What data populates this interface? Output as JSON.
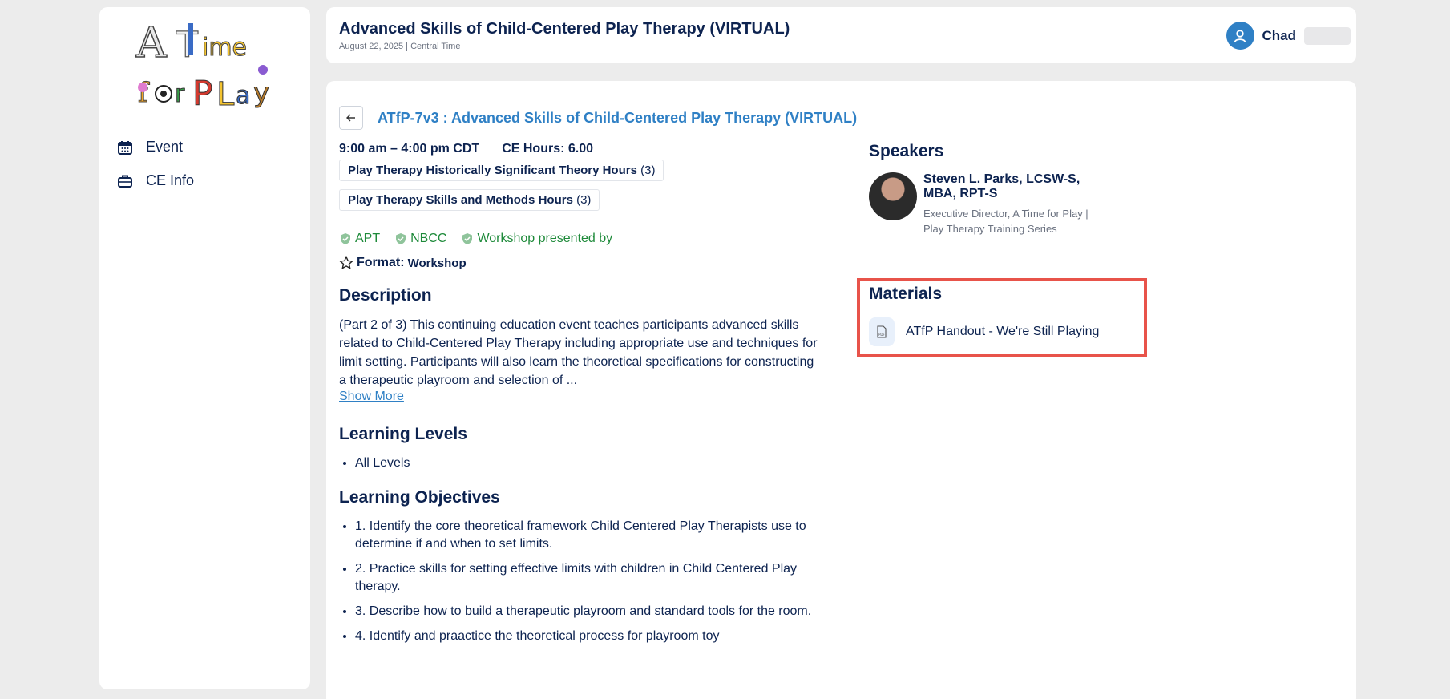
{
  "sidebar": {
    "logo_text_line1": "A Time",
    "logo_text_line2": "for Play",
    "items": [
      {
        "label": "Event",
        "icon": "calendar-icon"
      },
      {
        "label": "CE Info",
        "icon": "briefcase-icon"
      }
    ]
  },
  "header": {
    "title": "Advanced Skills of Child-Centered Play Therapy (VIRTUAL)",
    "subtitle": "August 22, 2025 | Central Time",
    "user_name": "Chad"
  },
  "event": {
    "title": "ATfP-7v3 : Advanced Skills of Child-Centered Play Therapy (VIRTUAL)",
    "time": "9:00 am – 4:00 pm CDT",
    "ce_hours": "CE Hours: 6.00",
    "tags": [
      {
        "label": "Play Therapy Historically Significant Theory Hours",
        "count": "(3)"
      },
      {
        "label": "Play Therapy Skills and Methods Hours",
        "count": "(3)"
      }
    ],
    "badges": [
      "APT",
      "NBCC",
      "Workshop presented by"
    ],
    "format_label": "Format:",
    "format_value": "Workshop"
  },
  "description": {
    "heading": "Description",
    "text": "(Part 2 of 3) This continuing education event teaches participants advanced skills related to Child-Centered Play Therapy including appropriate use and techniques for limit setting. Participants will also learn the theoretical specifications for constructing a therapeutic playroom and selection of ...",
    "show_more": "Show More"
  },
  "learning_levels": {
    "heading": "Learning Levels",
    "items": [
      "All Levels"
    ]
  },
  "learning_objectives": {
    "heading": "Learning Objectives",
    "items": [
      "1. Identify the core theoretical framework Child Centered Play Therapists use to determine if and when to set limits.",
      "2. Practice skills for setting effective limits with children in Child Centered Play therapy.",
      "3. Describe how to build a therapeutic playroom and standard tools for the room.",
      "4. Identify and praactice the theoretical process for playroom toy"
    ]
  },
  "speakers": {
    "heading": "Speakers",
    "items": [
      {
        "name": "Steven L. Parks, LCSW-S, MBA, RPT-S",
        "role": "Executive Director, A Time for Play | Play Therapy Training Series"
      }
    ]
  },
  "materials": {
    "heading": "Materials",
    "items": [
      {
        "label": "ATfP Handout - We're Still Playing",
        "icon": "pdf-file-icon"
      }
    ]
  },
  "colors": {
    "accent": "#2f80c5",
    "text": "#0d2350",
    "success": "#1e8a3a",
    "highlight": "#e8534a"
  }
}
